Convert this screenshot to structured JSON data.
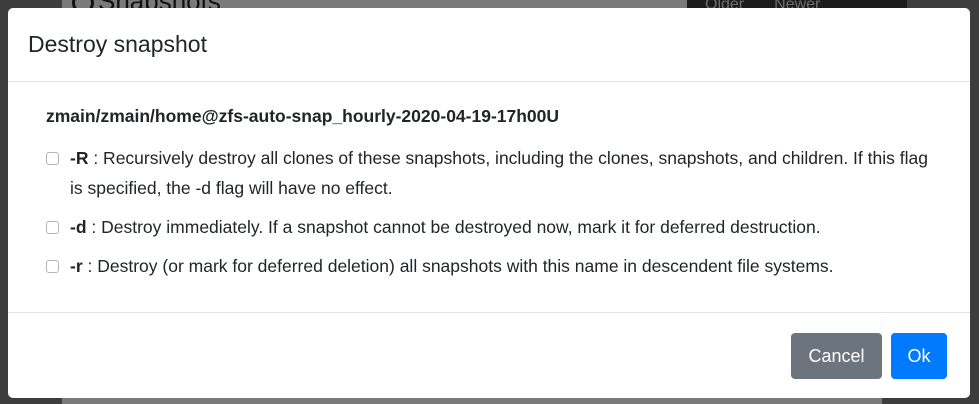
{
  "background": {
    "section_title": "Snapshots",
    "pager_older": "Older",
    "pager_newer": "Newer"
  },
  "modal": {
    "title": "Destroy snapshot",
    "snapshot_name": "zmain/zmain/home@zfs-auto-snap_hourly-2020-04-19-17h00U",
    "options": [
      {
        "flag": "-R",
        "description": " : Recursively destroy all clones of these snapshots, including the clones, snapshots, and children. If this flag is specified, the -d flag will have no effect.",
        "checked": false
      },
      {
        "flag": "-d",
        "description": " : Destroy immediately. If a snapshot cannot be destroyed now, mark it for deferred destruction.",
        "checked": false
      },
      {
        "flag": "-r",
        "description": " : Destroy (or mark for deferred deletion) all snapshots with this name in descendent file systems.",
        "checked": false
      }
    ],
    "buttons": {
      "cancel": "Cancel",
      "ok": "Ok"
    }
  },
  "colors": {
    "cancel_button": "#6c757d",
    "ok_button": "#007bff",
    "overlay": "rgba(0,0,0,0.5)"
  }
}
